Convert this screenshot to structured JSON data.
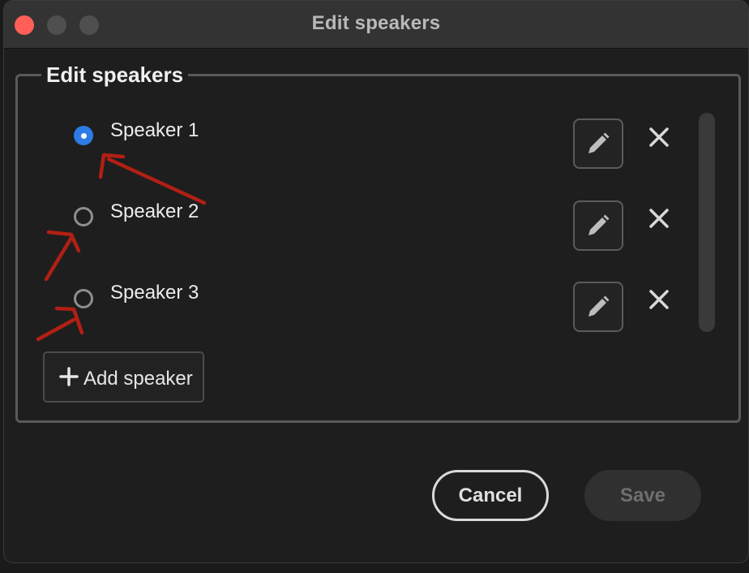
{
  "window": {
    "title": "Edit speakers"
  },
  "section": {
    "legend": "Edit speakers"
  },
  "speakers": [
    {
      "label": "Speaker 1",
      "selected": true
    },
    {
      "label": "Speaker 2",
      "selected": false
    },
    {
      "label": "Speaker 3",
      "selected": false
    }
  ],
  "icons": {
    "edit": "pencil-icon",
    "remove": "close-icon",
    "add": "plus-icon"
  },
  "add_speaker": {
    "label": "Add speaker"
  },
  "footer": {
    "cancel_label": "Cancel",
    "save_label": "Save",
    "save_enabled": false
  },
  "colors": {
    "accent": "#2d7be4",
    "close_light": "#ff5f57",
    "annotation": "#b21f14"
  }
}
